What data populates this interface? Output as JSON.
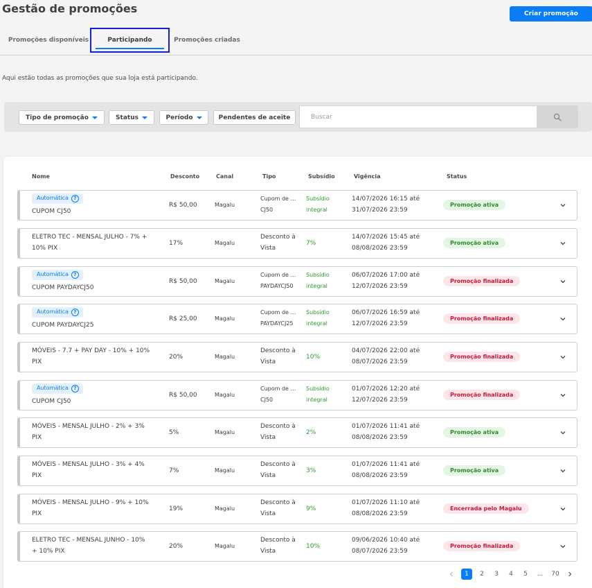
{
  "header": {
    "title": "Gestão de promoções",
    "create_label": "Criar promoção"
  },
  "tabs": [
    {
      "label": "Promoções disponíveis"
    },
    {
      "label": "Participando"
    },
    {
      "label": "Promoções criadas"
    }
  ],
  "description": "Aqui estão todas as promoções que sua loja está participando.",
  "filters": {
    "tipo": "Tipo de promoção",
    "status": "Status",
    "periodo": "Período",
    "pendentes": "Pendentes de aceite",
    "search_placeholder": "Buscar"
  },
  "columns": [
    "Nome",
    "Desconto",
    "Canal",
    "Tipo",
    "Subsídio",
    "Vigência",
    "Status"
  ],
  "auto_label": "Automática",
  "rows": [
    {
      "auto": true,
      "name": "CUPOM CJ50",
      "desconto": "R$ 50,00",
      "canal": "Magalu",
      "tipo": "Cupom de ...\nCJ50",
      "subsidio": "Subsídio\nintegral",
      "vigencia": "14/07/2026 16:15 até\n31/07/2026 23:59",
      "status": "Promoção ativa",
      "status_kind": "ativa"
    },
    {
      "auto": false,
      "name": "ELETRO TEC - MENSAL JULHO - 7% +\n10% PIX",
      "desconto": "17%",
      "canal": "Magalu",
      "tipo": "Desconto à\nVista",
      "subsidio": "7%",
      "vigencia": "14/07/2026 15:45 até\n08/08/2026 23:59",
      "status": "Promoção ativa",
      "status_kind": "ativa"
    },
    {
      "auto": true,
      "name": "CUPOM PAYDAYCJ50",
      "desconto": "R$ 50,00",
      "canal": "Magalu",
      "tipo": "Cupom de ...\nPAYDAYCJ50",
      "subsidio": "Subsídio\nintegral",
      "vigencia": "06/07/2026 17:00 até\n12/07/2026 23:59",
      "status": "Promoção finalizada",
      "status_kind": "fin"
    },
    {
      "auto": true,
      "name": "CUPOM PAYDAYCJ25",
      "desconto": "R$ 25,00",
      "canal": "Magalu",
      "tipo": "Cupom de ...\nPAYDAYCJ25",
      "subsidio": "Subsídio\nintegral",
      "vigencia": "06/07/2026 16:59 até\n12/07/2026 23:59",
      "status": "Promoção finalizada",
      "status_kind": "fin"
    },
    {
      "auto": false,
      "name": "MÓVEIS - 7.7 + PAY DAY - 10% + 10%\nPIX",
      "desconto": "20%",
      "canal": "Magalu",
      "tipo": "Desconto à\nVista",
      "subsidio": "10%",
      "vigencia": "04/07/2026 22:00 até\n08/07/2026 23:59",
      "status": "Promoção finalizada",
      "status_kind": "fin"
    },
    {
      "auto": true,
      "name": "CUPOM CJ50",
      "desconto": "R$ 50,00",
      "canal": "Magalu",
      "tipo": "Cupom de ...\nCJ50",
      "subsidio": "Subsídio\nintegral",
      "vigencia": "01/07/2026 12:20 até\n12/07/2026 23:59",
      "status": "Promoção finalizada",
      "status_kind": "fin"
    },
    {
      "auto": false,
      "name": "MÓVEIS - MENSAL JULHO - 2% + 3%\nPIX",
      "desconto": "5%",
      "canal": "Magalu",
      "tipo": "Desconto à\nVista",
      "subsidio": "2%",
      "vigencia": "01/07/2026 11:41 até\n08/08/2026 23:59",
      "status": "Promoção ativa",
      "status_kind": "ativa"
    },
    {
      "auto": false,
      "name": "MÓVEIS - MENSAL JULHO - 3% + 4%\nPIX",
      "desconto": "7%",
      "canal": "Magalu",
      "tipo": "Desconto à\nVista",
      "subsidio": "3%",
      "vigencia": "01/07/2026 11:41 até\n08/08/2026 23:59",
      "status": "Promoção ativa",
      "status_kind": "ativa"
    },
    {
      "auto": false,
      "name": "MÓVEIS - MENSAL JULHO - 9% + 10%\nPIX",
      "desconto": "19%",
      "canal": "Magalu",
      "tipo": "Desconto à\nVista",
      "subsidio": "9%",
      "vigencia": "01/07/2026 11:10 até\n08/08/2026 23:59",
      "status": "Encerrada pelo Magalu",
      "status_kind": "fin"
    },
    {
      "auto": false,
      "name": "ELETRO TEC - MENSAL JUNHO - 10%\n+ 10% PIX",
      "desconto": "20%",
      "canal": "Magalu",
      "tipo": "Desconto à\nVista",
      "subsidio": "10%",
      "vigencia": "09/06/2026 10:40 até\n08/07/2026 23:59",
      "status": "Promoção finalizada",
      "status_kind": "fin"
    }
  ],
  "pagination": {
    "pages": [
      "1",
      "2",
      "3",
      "4",
      "5",
      "...",
      "70"
    ],
    "current": "1"
  },
  "colors": {
    "accent": "#0a7cf5",
    "active_green": "#2e8a2e",
    "finished_red": "#c61a3a",
    "subsidy_green": "#2e9b2e"
  }
}
